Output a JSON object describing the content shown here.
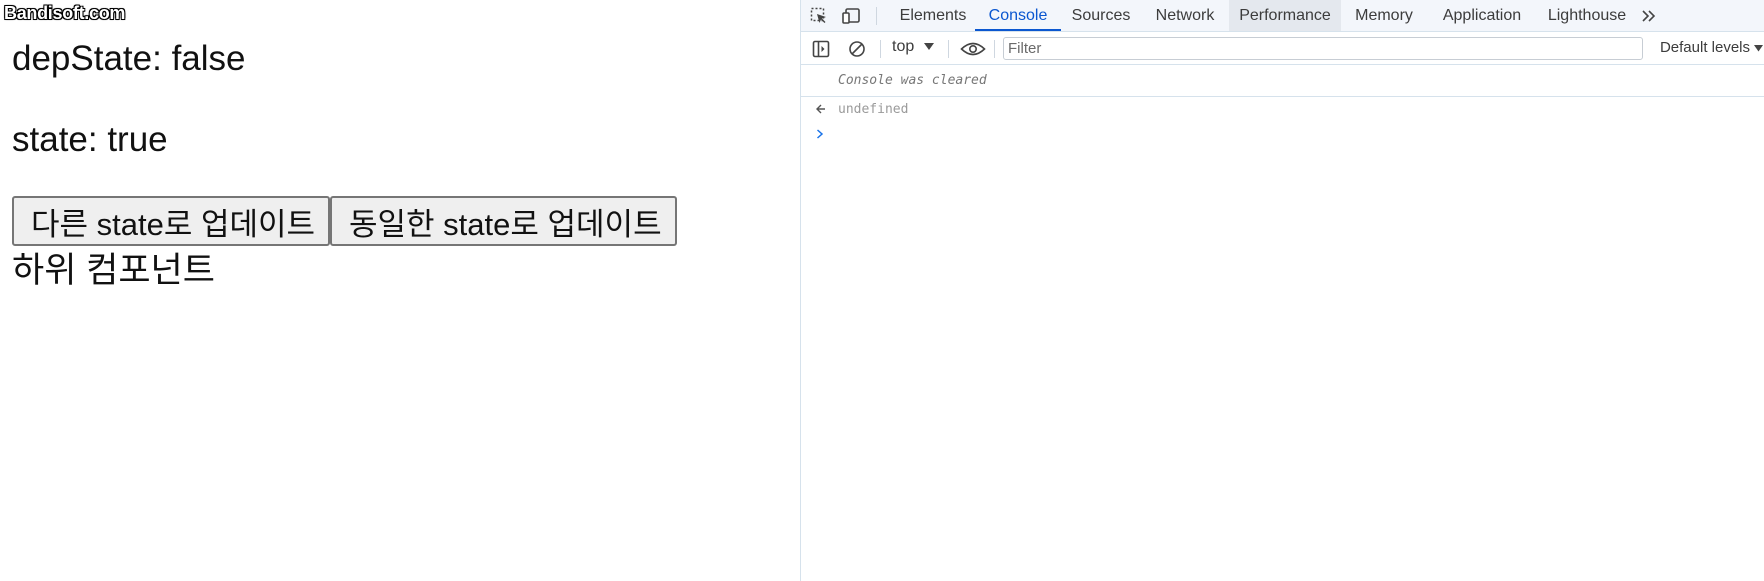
{
  "watermark": "Bandisoft.com",
  "page": {
    "dep_state_text": "depState: false",
    "state_text": "state: true",
    "buttons": {
      "different_label": "다른 state로 업데이트",
      "same_label": "동일한 state로 업데이트"
    },
    "child_component_text": "하위 컴포넌트"
  },
  "devtools": {
    "tabs": [
      {
        "label": "Elements"
      },
      {
        "label": "Console",
        "active": true
      },
      {
        "label": "Sources"
      },
      {
        "label": "Network"
      },
      {
        "label": "Performance",
        "hover": true
      },
      {
        "label": "Memory"
      },
      {
        "label": "Application"
      },
      {
        "label": "Lighthouse"
      }
    ],
    "more_tabs_icon": "double-chevron-right-icon",
    "toolbar": {
      "context": "top",
      "filter_placeholder": "Filter",
      "levels": "Default levels"
    },
    "console": {
      "cleared_message": "Console was cleared",
      "result_value": "undefined"
    }
  },
  "colors": {
    "accent": "#0b57d0",
    "tabbar_bg": "#f3f6fb",
    "border": "#d6e2ec"
  }
}
